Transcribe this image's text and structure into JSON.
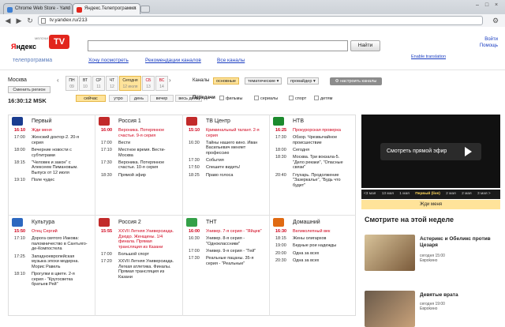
{
  "browser": {
    "tabs": [
      {
        "title": "Chrome Web Store - Yand",
        "fav": "#3d7fd3"
      },
      {
        "title": "Яндекс.Телепрограмма",
        "fav": "#e2261d"
      }
    ],
    "url": "tv.yandex.ru/213"
  },
  "header": {
    "logo_text_a": "Я",
    "logo_text_b": "ндекс",
    "logo_tv": "TV",
    "logo_small": "МЕЛОЧИ ЗДЕСЬ",
    "search_button": "Найти",
    "corner_links": [
      "Войти",
      "Помощь"
    ],
    "enable_translation": "Enable translation",
    "brand_link": "телепрограмма",
    "top_links": [
      "Хочу посмотреть",
      "Рекомендации каналов",
      "Все каналы"
    ]
  },
  "filters": {
    "city": "Москва",
    "city_button": "Сменить регион",
    "clock": "16:30:12 MSK",
    "days": [
      {
        "name": "ПН",
        "num": "09"
      },
      {
        "name": "ВТ",
        "num": "10"
      },
      {
        "name": "СР",
        "num": "11"
      },
      {
        "name": "ЧТ",
        "num": "12"
      },
      {
        "name": "Сегодня",
        "num": "12 июля"
      },
      {
        "name": "СБ",
        "num": "13"
      },
      {
        "name": "ВС",
        "num": "14"
      }
    ],
    "now_label": "сейчас",
    "periods": [
      "утро",
      "день",
      "вечер",
      "весь день"
    ],
    "channels_label": "Каналы",
    "channel_pills": [
      "основные",
      "тематические ▾",
      "провайдер ▾"
    ],
    "settings_button": "настроить каналы",
    "shows_label": "Передачи",
    "checkboxes": [
      "фильмы",
      "сериалы",
      "спорт",
      "детям"
    ]
  },
  "channels": [
    {
      "name": "Первый",
      "color": "#1a3c8f",
      "programs": [
        {
          "time": "16:10",
          "title": "Жди меня",
          "on": true
        },
        {
          "time": "17:00",
          "title": "Женский доктор-2. 20-я серия"
        },
        {
          "time": "18:00",
          "title": "Вечерние новости с субтитрами"
        },
        {
          "time": "18:15",
          "title": "\"Человек и закон\" с Алексеем Пимановым. Выпуск от 12 июля"
        },
        {
          "time": "19:10",
          "title": "Поле чудес"
        }
      ]
    },
    {
      "name": "Россия 1",
      "color": "#c22a2a",
      "programs": [
        {
          "time": "16:00",
          "title": "Вероника. Потерянное счастье. 9-я серия",
          "on": true
        },
        {
          "time": "17:00",
          "title": "Вести"
        },
        {
          "time": "17:10",
          "title": "Местное время. Вести-Москва"
        },
        {
          "time": "17:30",
          "title": "Вероника. Потерянное счастье. 10-я серия"
        },
        {
          "time": "18:30",
          "title": "Прямой эфир"
        }
      ]
    },
    {
      "name": "ТВ Центр",
      "color": "#c22a2a",
      "programs": [
        {
          "time": "15:10",
          "title": "Криминальный талант. 2-я серия",
          "on": true
        },
        {
          "time": "16:30",
          "title": "Тайны нашего кино. Иван Васильевич меняет профессию"
        },
        {
          "time": "17:30",
          "title": "События"
        },
        {
          "time": "17:50",
          "title": "Спешите видеть!"
        },
        {
          "time": "18:25",
          "title": "Право голоса"
        }
      ]
    },
    {
      "name": "НТВ",
      "color": "#1c8a2e",
      "programs": [
        {
          "time": "16:25",
          "title": "Прокурорская проверка",
          "on": true
        },
        {
          "time": "17:30",
          "title": "Обзор. Чрезвычайное происшествие"
        },
        {
          "time": "18:00",
          "title": "Сегодня"
        },
        {
          "time": "18:30",
          "title": "Москва. Три вокзала-5. \"Дело рекаки\", \"Опасные связи\""
        },
        {
          "time": "20:40",
          "title": "Глухарь. Продолжение \"Зазеркалье\", \"Будь что будет\""
        }
      ]
    },
    {
      "name": "Культура",
      "color": "#2c68c0",
      "programs": [
        {
          "time": "15:50",
          "title": "Отец Сергий",
          "on": true
        },
        {
          "time": "17:10",
          "title": "Дорога святого Иакова: паломничество в Сантьяго-де-Компостела"
        },
        {
          "time": "17:25",
          "title": "Западноевропейская музыка эпохи модерна. Морис Равель"
        },
        {
          "time": "18:10",
          "title": "Прогулки в цвете. 2-я серия - \"Кругосветка братьев Рей\""
        }
      ]
    },
    {
      "name": "Россия 2",
      "color": "#c22a2a",
      "programs": [
        {
          "time": "15:55",
          "title": "XXVII Летняя Универсиада. Дзюдо. Женщины. 1/4 финала. Прямая трансляция из Казани",
          "on": true
        },
        {
          "time": "17:00",
          "title": "Большой спорт"
        },
        {
          "time": "17:20",
          "title": "XXVII Летняя Универсиада. Легкая атлетика. Финалы. Прямая трансляция из Казани"
        }
      ]
    },
    {
      "name": "ТНТ",
      "color": "#34a048",
      "programs": [
        {
          "time": "16:00",
          "title": "Универ. 7-я серия - \"Яйцев\"",
          "on": true
        },
        {
          "time": "16:30",
          "title": "Универ. 8-я серия - \"Одноклассники\""
        },
        {
          "time": "17:00",
          "title": "Универ. 9-я серия - \"Гей\""
        },
        {
          "time": "17:30",
          "title": "Реальные пацаны. 35-я серия - \"Реальные\""
        }
      ]
    },
    {
      "name": "Домашний",
      "color": "#e06a12",
      "programs": [
        {
          "time": "16:30",
          "title": "Великолепный век",
          "on": true
        },
        {
          "time": "18:15",
          "title": "Жены олигархов"
        },
        {
          "time": "19:00",
          "title": "Бедные рои надежды"
        },
        {
          "time": "20:00",
          "title": "Одна за всех"
        },
        {
          "time": "20:30",
          "title": "Одна за всех"
        }
      ]
    }
  ],
  "sidebar": {
    "live_button": "Смотреть прямой эфир",
    "ticker": [
      "<3 мая",
      "13 мая",
      "1 мая",
      "Первый (live)",
      "2 мая",
      "2 мая",
      "3 мая >"
    ],
    "now_playing": "Жди меня",
    "week_title": "Смотрите на этой неделе",
    "cards": [
      {
        "title": "Астерикс и Обеликс против Цезаря",
        "meta1": "сегодня 15:00",
        "meta2": "Евроkино",
        "color": "#b08a5a"
      },
      {
        "title": "Девятые врата",
        "meta1": "сегодня 19:00",
        "meta2": "Евроkино",
        "color": "#8a6a4a"
      }
    ]
  }
}
